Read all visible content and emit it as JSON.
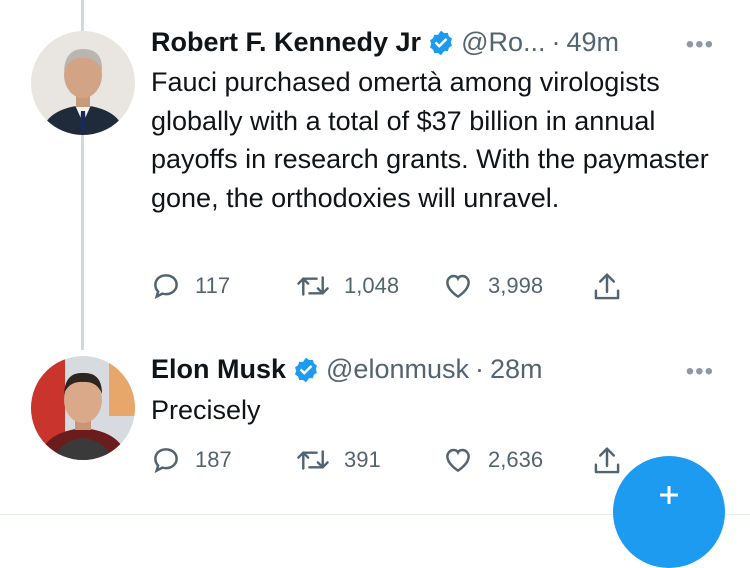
{
  "tweets": [
    {
      "author": "Robert F. Kennedy Jr",
      "handle": "@Ro...",
      "separator": "·",
      "time": "49m",
      "more": "•••",
      "text": "Fauci purchased omertà among virologists globally with a total of $37 billion in annual payoffs in research grants. With the paymaster gone, the orthodoxies will unravel.",
      "replies": "117",
      "retweets": "1,048",
      "likes": "3,998"
    },
    {
      "author": "Elon Musk",
      "handle": "@elonmusk",
      "separator": "·",
      "time": "28m",
      "more": "•••",
      "text": "Precisely",
      "replies": "187",
      "retweets": "391",
      "likes": "2,636"
    }
  ],
  "icons": {
    "reply": "reply-icon",
    "retweet": "retweet-icon",
    "like": "heart-icon",
    "share": "share-icon",
    "verified": "verified-badge-icon",
    "compose": "compose-plus-icon"
  },
  "colors": {
    "accent": "#1d9bf0",
    "secondary_text": "#536471",
    "thread_line": "#cfd9de"
  }
}
